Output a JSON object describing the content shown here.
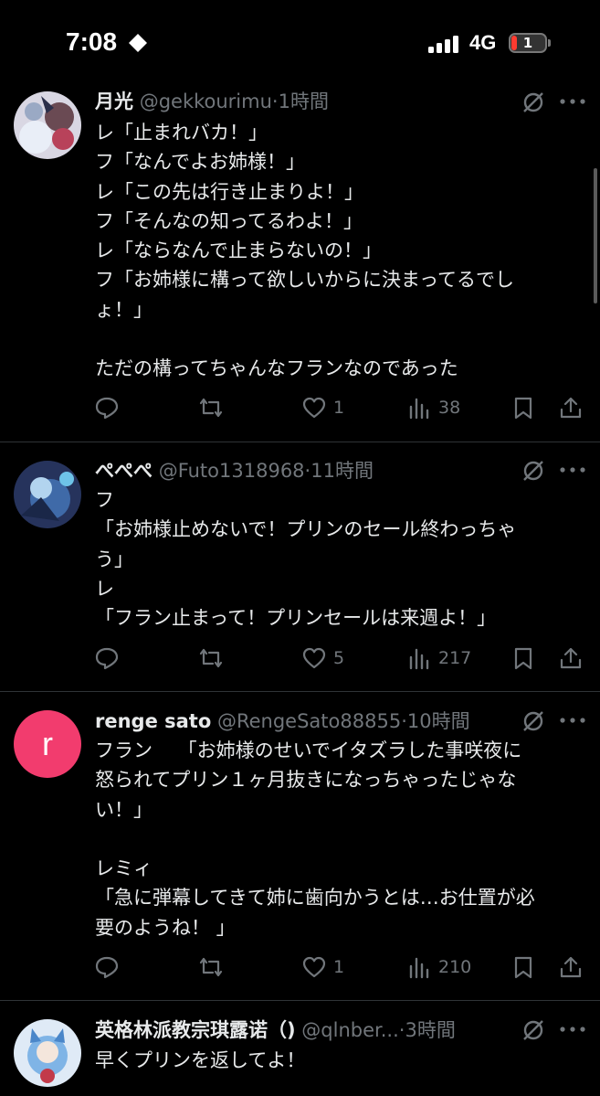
{
  "status_bar": {
    "time": "7:08",
    "network": "4G",
    "battery": "1"
  },
  "posts": [
    {
      "name": "月光",
      "handle": "@gekkourimu",
      "dot": "·",
      "ago": "1時間",
      "lines": [
        "レ「止まれバカ！」",
        "フ「なんでよお姉様！」",
        "レ「この先は行き止まりよ！」",
        "フ「そんなの知ってるわよ！」",
        "レ「ならなんで止まらないの！」",
        "フ「お姉様に構って欲しいからに決まってるでし",
        "ょ！」",
        "",
        "ただの構ってちゃんなフランなのであった"
      ],
      "likes": "1",
      "views": "38"
    },
    {
      "name": "ぺぺぺ",
      "handle": "@Futo1318968",
      "dot": "·",
      "ago": "11時間",
      "lines": [
        "フ",
        "「お姉様止めないで！プリンのセール終わっちゃ",
        "う」",
        "レ",
        "「フラン止まって！プリンセールは来週よ！」"
      ],
      "likes": "5",
      "views": "217"
    },
    {
      "name": "renge sato",
      "handle": "@RengeSato88855",
      "dot": "·",
      "ago": "10時間",
      "avatar_letter": "r",
      "lines": [
        "フラン　 「お姉様のせいでイタズラした事咲夜に",
        "怒られてプリン１ヶ月抜きになっちゃったじゃな",
        "い！」",
        "",
        "レミィ",
        "「急に弾幕してきて姉に歯向かうとは…お仕置が必",
        "要のようね！ 」"
      ],
      "likes": "1",
      "views": "210"
    },
    {
      "name": "英格林派教宗琪露诺（)",
      "handle": "@qlnber...",
      "dot": "·",
      "ago": "3時間",
      "lines": [
        "早くプリンを返してよ！"
      ],
      "likes": "",
      "views": ""
    }
  ],
  "colors": {
    "background": "#000000",
    "text": "#e7e9ea",
    "secondary": "#71767b",
    "separator": "#2f3336",
    "avatar_pink": "#f23c6e"
  },
  "icons": [
    "reply-icon",
    "repost-icon",
    "like-icon",
    "views-icon",
    "bookmark-icon",
    "share-icon",
    "grok-icon",
    "more-icon"
  ]
}
